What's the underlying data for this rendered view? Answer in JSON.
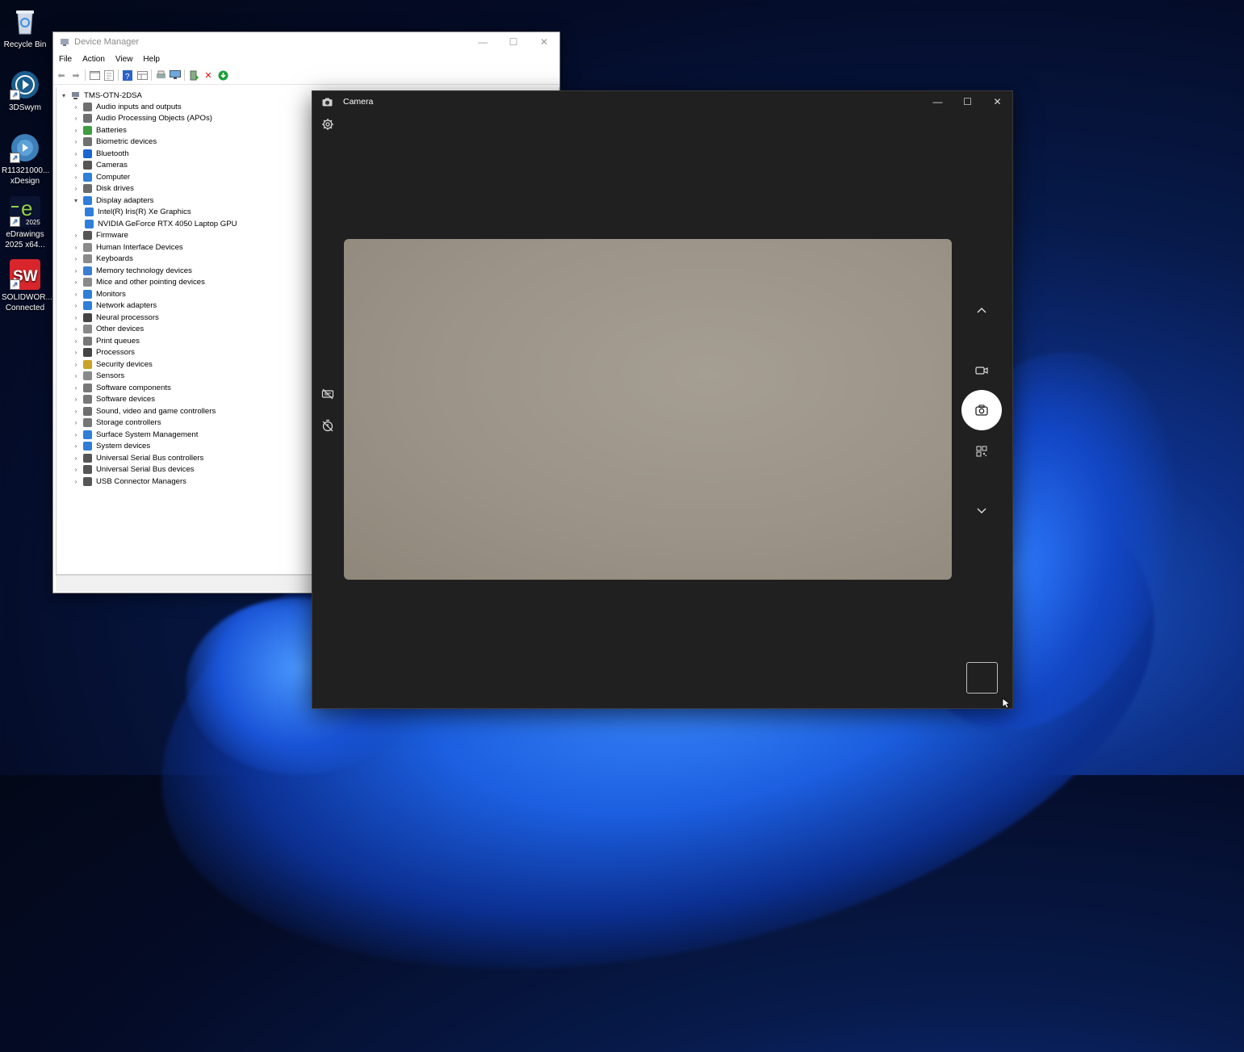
{
  "desktop": {
    "icons": [
      {
        "label": "Recycle Bin",
        "icon": "recycle-bin-icon"
      },
      {
        "label": "3DSwym",
        "icon": "3dswym-icon"
      },
      {
        "label": "R11321000...",
        "label2": "xDesign",
        "icon": "xdesign-icon"
      },
      {
        "label": "eDrawings",
        "label2": "2025 x64...",
        "icon": "edrawings-icon",
        "badge": "2025"
      },
      {
        "label": "SOLIDWOR...",
        "label2": "Connected",
        "icon": "solidworks-icon",
        "badge": "SW"
      }
    ]
  },
  "device_manager": {
    "title": "Device Manager",
    "menu": [
      "File",
      "Action",
      "View",
      "Help"
    ],
    "root": "TMS-OTN-2DSA",
    "tree": [
      {
        "label": "Audio inputs and outputs",
        "expanded": false,
        "color": "#6f6f6f"
      },
      {
        "label": "Audio Processing Objects (APOs)",
        "expanded": false,
        "color": "#6f6f6f"
      },
      {
        "label": "Batteries",
        "expanded": false,
        "color": "#3f9c3f"
      },
      {
        "label": "Biometric devices",
        "expanded": false,
        "color": "#707070"
      },
      {
        "label": "Bluetooth",
        "expanded": false,
        "color": "#1a66d2"
      },
      {
        "label": "Cameras",
        "expanded": false,
        "color": "#555555"
      },
      {
        "label": "Computer",
        "expanded": false,
        "color": "#2f7fd8"
      },
      {
        "label": "Disk drives",
        "expanded": false,
        "color": "#6a6a6a"
      },
      {
        "label": "Display adapters",
        "expanded": true,
        "color": "#2f7fd8"
      },
      {
        "label": "Intel(R) Iris(R) Xe Graphics",
        "child": true,
        "color": "#2f7fd8"
      },
      {
        "label": "NVIDIA GeForce RTX 4050 Laptop GPU",
        "child": true,
        "color": "#2f7fd8"
      },
      {
        "label": "Firmware",
        "expanded": false,
        "color": "#555555"
      },
      {
        "label": "Human Interface Devices",
        "expanded": false,
        "color": "#8a8a8a"
      },
      {
        "label": "Keyboards",
        "expanded": false,
        "color": "#8a8a8a"
      },
      {
        "label": "Memory technology devices",
        "expanded": false,
        "color": "#3a7fd0"
      },
      {
        "label": "Mice and other pointing devices",
        "expanded": false,
        "color": "#8a8a8a"
      },
      {
        "label": "Monitors",
        "expanded": false,
        "color": "#2f7fd8"
      },
      {
        "label": "Network adapters",
        "expanded": false,
        "color": "#2f7fd8"
      },
      {
        "label": "Neural processors",
        "expanded": false,
        "color": "#444444"
      },
      {
        "label": "Other devices",
        "expanded": false,
        "color": "#888888"
      },
      {
        "label": "Print queues",
        "expanded": false,
        "color": "#777777"
      },
      {
        "label": "Processors",
        "expanded": false,
        "color": "#444444"
      },
      {
        "label": "Security devices",
        "expanded": false,
        "color": "#c9a227"
      },
      {
        "label": "Sensors",
        "expanded": false,
        "color": "#8a8a8a"
      },
      {
        "label": "Software components",
        "expanded": false,
        "color": "#777777"
      },
      {
        "label": "Software devices",
        "expanded": false,
        "color": "#777777"
      },
      {
        "label": "Sound, video and game controllers",
        "expanded": false,
        "color": "#6f6f6f"
      },
      {
        "label": "Storage controllers",
        "expanded": false,
        "color": "#777777"
      },
      {
        "label": "Surface System Management",
        "expanded": false,
        "color": "#2f7fd8"
      },
      {
        "label": "System devices",
        "expanded": false,
        "color": "#2f7fd8"
      },
      {
        "label": "Universal Serial Bus controllers",
        "expanded": false,
        "color": "#555555"
      },
      {
        "label": "Universal Serial Bus devices",
        "expanded": false,
        "color": "#555555"
      },
      {
        "label": "USB Connector Managers",
        "expanded": false,
        "color": "#555555"
      }
    ]
  },
  "camera": {
    "title": "Camera"
  }
}
